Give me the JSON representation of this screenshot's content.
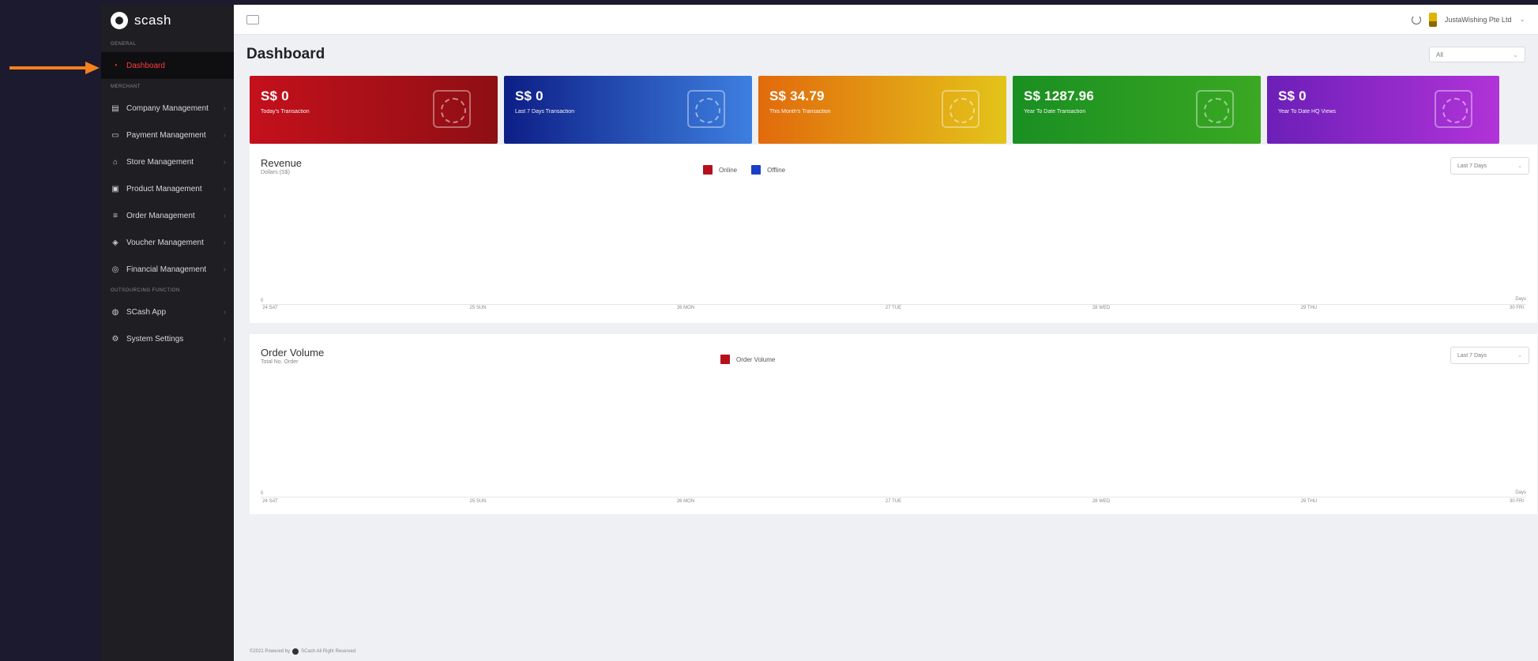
{
  "brand": {
    "name": "scash"
  },
  "sidebar": {
    "sections": [
      {
        "label": "GENERAL"
      },
      {
        "label": "MERCHANT"
      },
      {
        "label": "OUTSOURCING FUNCTION"
      }
    ],
    "items": [
      {
        "label": "Dashboard",
        "icon": "speedometer-icon",
        "section": 0,
        "active": true
      },
      {
        "label": "Company Management",
        "icon": "building-icon",
        "section": 1
      },
      {
        "label": "Payment Management",
        "icon": "card-icon",
        "section": 1
      },
      {
        "label": "Store Management",
        "icon": "store-icon",
        "section": 1
      },
      {
        "label": "Product Management",
        "icon": "box-icon",
        "section": 1
      },
      {
        "label": "Order Management",
        "icon": "order-icon",
        "section": 1
      },
      {
        "label": "Voucher Management",
        "icon": "voucher-icon",
        "section": 1
      },
      {
        "label": "Financial Management",
        "icon": "finance-icon",
        "section": 1
      },
      {
        "label": "SCash App",
        "icon": "app-icon",
        "section": 2
      },
      {
        "label": "System Settings",
        "icon": "settings-icon",
        "section": 2
      }
    ]
  },
  "topbar": {
    "company": "JustaWishing Pte Ltd"
  },
  "page": {
    "title": "Dashboard",
    "filter": "All"
  },
  "cards": [
    {
      "value": "S$ 0",
      "label": "Today's Transaction",
      "color": "#c4101c"
    },
    {
      "value": "S$ 0",
      "label": "Last 7 Days Transaction",
      "color": "#0d1e86"
    },
    {
      "value": "S$ 34.79",
      "label": "This Month's Transaction",
      "color": "#e26a0c"
    },
    {
      "value": "S$ 1287.96",
      "label": "Year To Date Transaction",
      "color": "#1a8f22"
    },
    {
      "value": "S$ 0",
      "label": "Year To Date HQ Views",
      "color": "#6c1fb8"
    }
  ],
  "revenue": {
    "title": "Revenue",
    "subtitle": "Dollars (S$)",
    "range": "Last 7 Days",
    "legend": [
      {
        "name": "Online",
        "color": "#b5101c"
      },
      {
        "name": "Offline",
        "color": "#1a3fc7"
      }
    ],
    "y_zero": "0",
    "x_unit": "Days",
    "ticks": [
      "24 SAT",
      "25 SUN",
      "26 MON",
      "27 TUE",
      "28 WED",
      "29 THU",
      "30 FRI"
    ]
  },
  "orders": {
    "title": "Order Volume",
    "subtitle": "Total No. Order",
    "range": "Last 7 Days",
    "legend": [
      {
        "name": "Order Volume",
        "color": "#b5101c"
      }
    ],
    "y_zero": "0",
    "x_unit": "Days",
    "ticks": [
      "24 SAT",
      "25 SUN",
      "26 MON",
      "27 TUE",
      "28 WED",
      "29 THU",
      "30 FRI"
    ]
  },
  "footer": {
    "text_before": "©2021 Powered by",
    "text_after": "SCash All Right Reserved"
  },
  "chart_data": [
    {
      "type": "bar",
      "title": "Revenue",
      "ylabel": "Dollars (S$)",
      "xlabel": "Days",
      "categories": [
        "24 SAT",
        "25 SUN",
        "26 MON",
        "27 TUE",
        "28 WED",
        "29 THU",
        "30 FRI"
      ],
      "series": [
        {
          "name": "Online",
          "values": [
            0,
            0,
            0,
            0,
            0,
            0,
            0
          ]
        },
        {
          "name": "Offline",
          "values": [
            0,
            0,
            0,
            0,
            0,
            0,
            0
          ]
        }
      ]
    },
    {
      "type": "bar",
      "title": "Order Volume",
      "ylabel": "Total No. Order",
      "xlabel": "Days",
      "categories": [
        "24 SAT",
        "25 SUN",
        "26 MON",
        "27 TUE",
        "28 WED",
        "29 THU",
        "30 FRI"
      ],
      "series": [
        {
          "name": "Order Volume",
          "values": [
            0,
            0,
            0,
            0,
            0,
            0,
            0
          ]
        }
      ]
    }
  ]
}
